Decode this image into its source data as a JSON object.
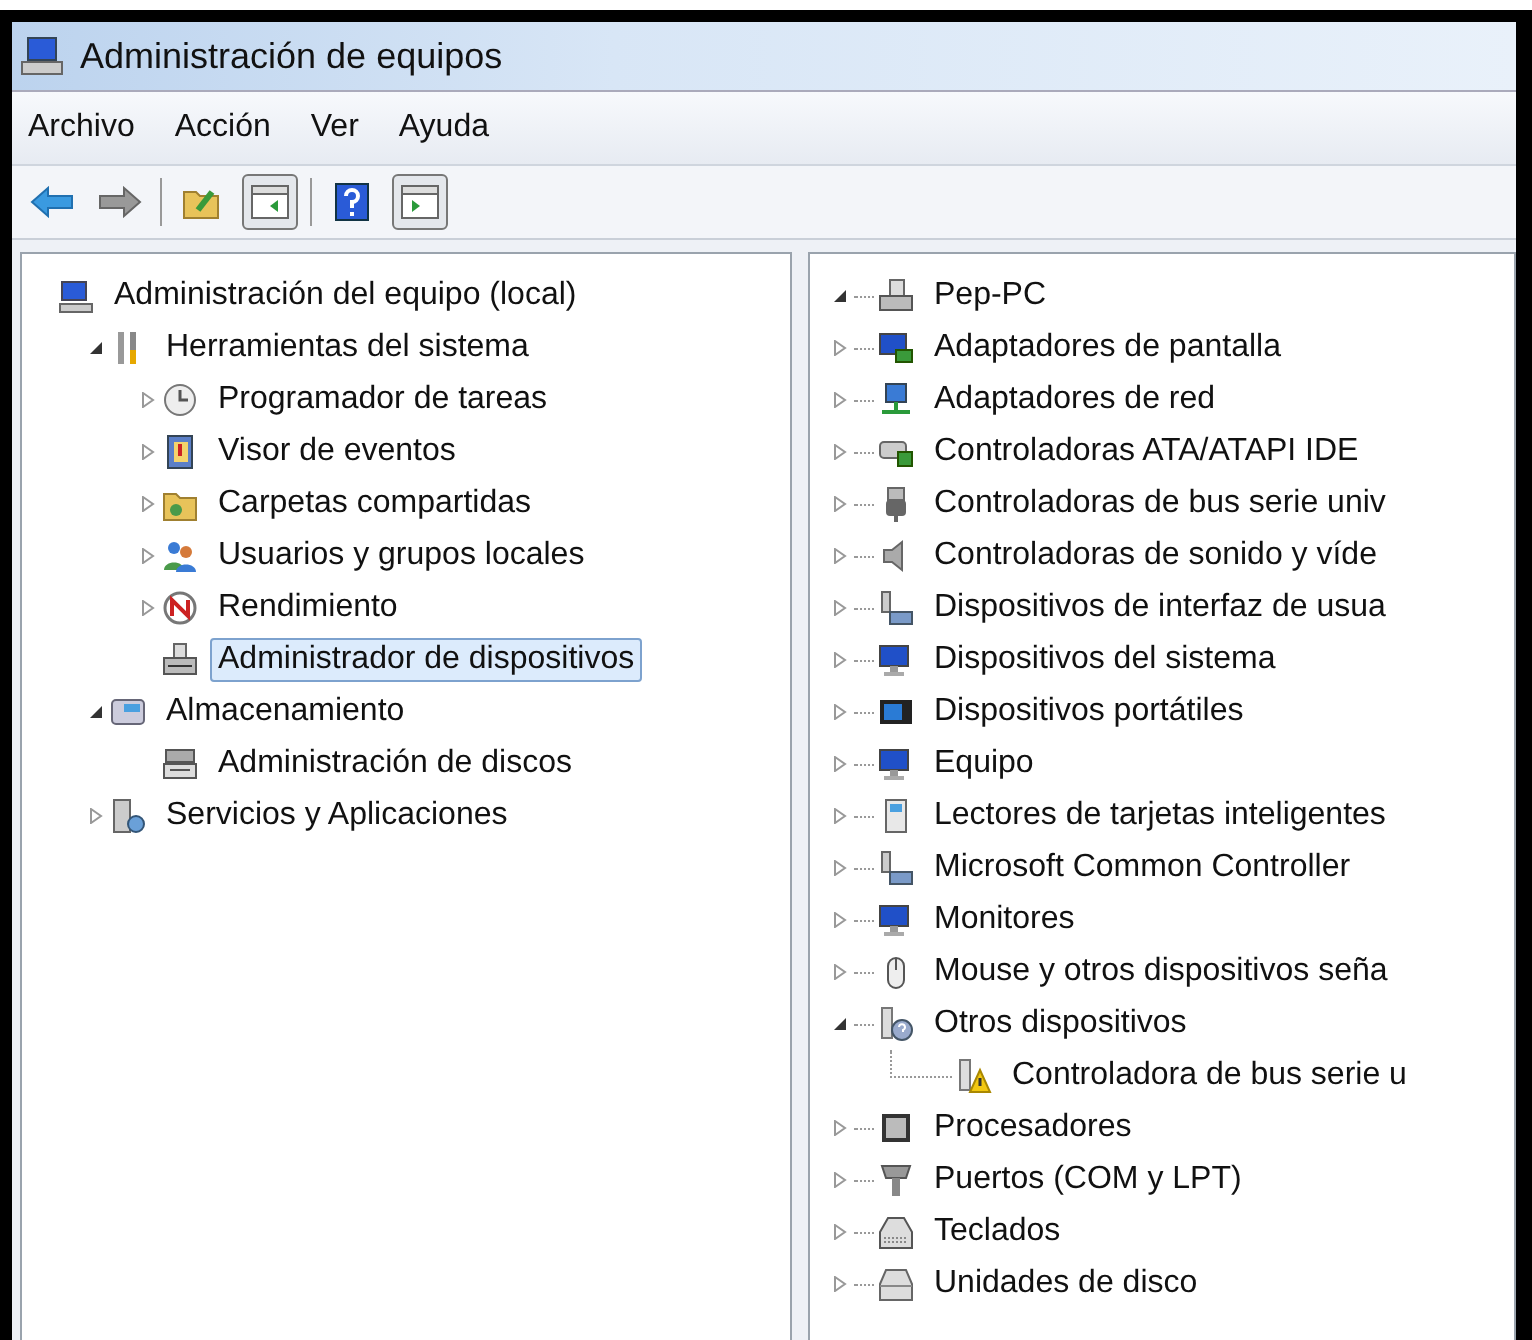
{
  "window": {
    "title": "Administración de equipos"
  },
  "menu": [
    {
      "label": "Archivo"
    },
    {
      "label": "Acción"
    },
    {
      "label": "Ver"
    },
    {
      "label": "Ayuda"
    }
  ],
  "console_tree": {
    "items": [
      {
        "label": "Administración del equipo (local)",
        "selected": false,
        "children": [
          {
            "label": "Herramientas del sistema",
            "expanded": true,
            "selected": false,
            "children": [
              {
                "label": "Programador de tareas",
                "expanded": false,
                "selected": false
              },
              {
                "label": "Visor de eventos",
                "expanded": false,
                "selected": false
              },
              {
                "label": "Carpetas compartidas",
                "expanded": false,
                "selected": false
              },
              {
                "label": "Usuarios y grupos locales",
                "expanded": false,
                "selected": false
              },
              {
                "label": "Rendimiento",
                "expanded": false,
                "selected": false
              },
              {
                "label": "Administrador de dispositivos",
                "selected": true
              }
            ]
          },
          {
            "label": "Almacenamiento",
            "expanded": true,
            "selected": false,
            "children": [
              {
                "label": "Administración de discos",
                "selected": false
              }
            ]
          },
          {
            "label": "Servicios y Aplicaciones",
            "expanded": false,
            "selected": false
          }
        ]
      }
    ]
  },
  "device_tree": {
    "items": [
      {
        "label": "Pep-PC",
        "expanded": true,
        "selected": false,
        "children": [
          {
            "label": "Adaptadores de pantalla",
            "expanded": false,
            "selected": false
          },
          {
            "label": "Adaptadores de red",
            "expanded": false,
            "selected": false
          },
          {
            "label": "Controladoras ATA/ATAPI IDE",
            "expanded": false,
            "selected": false
          },
          {
            "label": "Controladoras de bus serie univ",
            "expanded": false,
            "selected": false
          },
          {
            "label": "Controladoras de sonido y víde",
            "expanded": false,
            "selected": false
          },
          {
            "label": "Dispositivos de interfaz de usua",
            "expanded": false,
            "selected": false
          },
          {
            "label": "Dispositivos del sistema",
            "expanded": false,
            "selected": false
          },
          {
            "label": "Dispositivos portátiles",
            "expanded": false,
            "selected": false
          },
          {
            "label": "Equipo",
            "expanded": false,
            "selected": false
          },
          {
            "label": "Lectores de tarjetas inteligentes",
            "expanded": false,
            "selected": false
          },
          {
            "label": "Microsoft Common Controller",
            "expanded": false,
            "selected": false
          },
          {
            "label": "Monitores",
            "expanded": false,
            "selected": false
          },
          {
            "label": "Mouse y otros dispositivos seña",
            "expanded": false,
            "selected": false
          },
          {
            "label": "Otros dispositivos",
            "expanded": true,
            "selected": false,
            "children": [
              {
                "label": "Controladora de bus serie u",
                "selected": false
              }
            ]
          },
          {
            "label": "Procesadores",
            "expanded": false,
            "selected": false
          },
          {
            "label": "Puertos (COM y LPT)",
            "expanded": false,
            "selected": false
          },
          {
            "label": "Teclados",
            "expanded": false,
            "selected": false
          },
          {
            "label": "Unidades de disco",
            "expanded": false,
            "selected": false
          }
        ]
      }
    ]
  }
}
